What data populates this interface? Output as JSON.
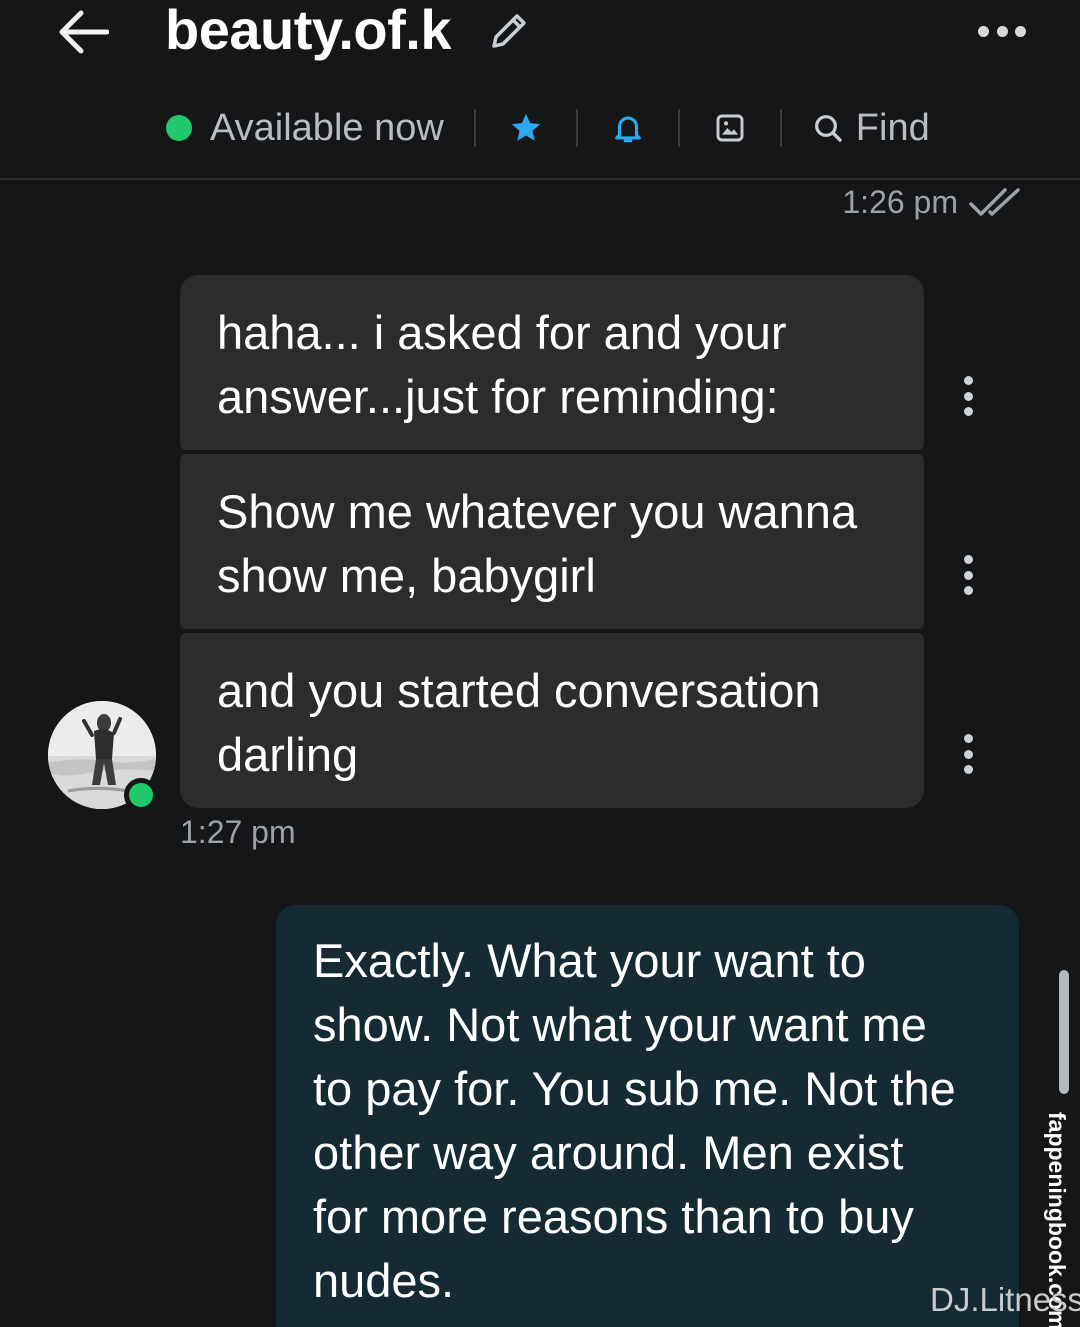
{
  "header": {
    "title": "beauty.of.k",
    "status_text": "Available now",
    "find_label": "Find",
    "icons": {
      "back": "arrow-left-icon",
      "edit": "pencil-icon",
      "more": "more-horizontal-icon",
      "favorite": "star-icon",
      "notifications": "bell-icon",
      "media": "image-icon",
      "find": "search-icon"
    }
  },
  "messages": {
    "top_timestamp": "1:26 pm",
    "incoming": [
      {
        "text_line1": "haha... i asked for and your",
        "text_line2": "answer...just for reminding:"
      },
      {
        "text_line1": "Show me whatever you wanna",
        "text_line2": "show me, babygirl"
      },
      {
        "text_line1": "and you started conversation",
        "text_line2": "darling"
      }
    ],
    "incoming_timestamp": "1:27 pm",
    "outgoing": {
      "lines": [
        "Exactly. What your want to",
        "show. Not what your want me",
        "to pay for. You sub me. Not the",
        "other way around. Men exist",
        "for more reasons than to buy",
        "nudes."
      ]
    }
  },
  "watermarks": {
    "side": "fappeningbook.com",
    "bottom": "DJ.Litness"
  },
  "colors": {
    "background": "#151617",
    "incoming_bubble": "#2a2c2e",
    "outgoing_bubble": "#152a33",
    "online": "#1ec86b",
    "accent_blue": "#2aa9f0"
  }
}
